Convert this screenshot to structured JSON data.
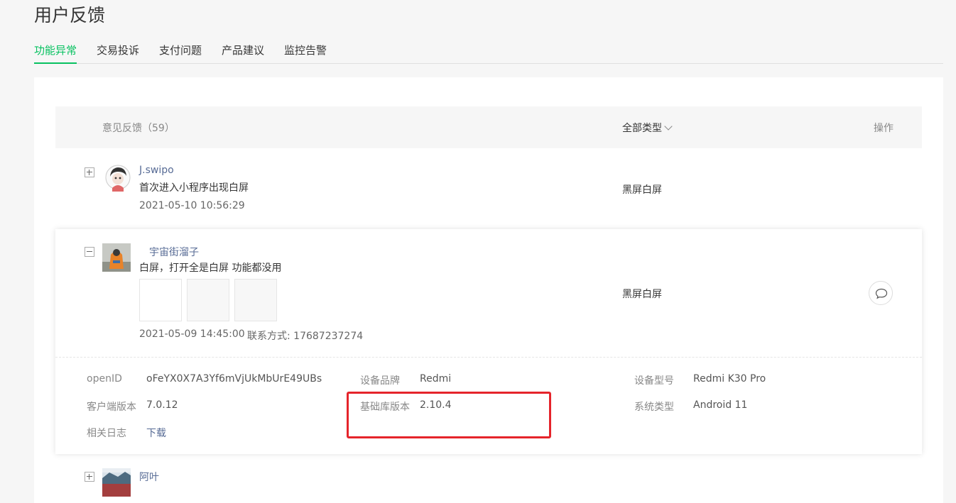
{
  "page": {
    "title": "用户反馈"
  },
  "tabs": [
    {
      "label": "功能异常",
      "active": true
    },
    {
      "label": "交易投诉",
      "active": false
    },
    {
      "label": "支付问题",
      "active": false
    },
    {
      "label": "产品建议",
      "active": false
    },
    {
      "label": "监控告警",
      "active": false
    }
  ],
  "table": {
    "header": {
      "feedback": "意见反馈（59）",
      "type": "全部类型",
      "actions": "操作"
    },
    "rows": [
      {
        "nickname": "J.swipo",
        "content": "首次进入小程序出现白屏",
        "time": "2021-05-10 10:56:29",
        "type": "黑屏白屏"
      },
      {
        "nickname": "宇宙街溜子",
        "content": "白屏，打开全是白屏 功能都没用",
        "time": "2021-05-09 14:45:00",
        "contact": "联系方式: 17687237274",
        "type": "黑屏白屏",
        "details": {
          "openid_label": "openID",
          "openid": "oFeYX0X7A3Yf6mVjUkMbUrE49UBs",
          "brand_label": "设备品牌",
          "brand": "Redmi",
          "model_label": "设备型号",
          "model": "Redmi K30 Pro",
          "client_label": "客户端版本",
          "client": "7.0.12",
          "lib_label": "基础库版本",
          "lib": "2.10.4",
          "os_label": "系统类型",
          "os": "Android 11",
          "log_label": "相关日志",
          "log_link": "下载"
        }
      },
      {
        "nickname": "阿叶"
      }
    ]
  },
  "colors": {
    "accent": "#07c160",
    "link": "#576b95",
    "highlight": "#e5242b"
  },
  "icons": {
    "reply": "comment-icon",
    "expand": "plus-square-icon",
    "collapse": "minus-square-icon"
  }
}
